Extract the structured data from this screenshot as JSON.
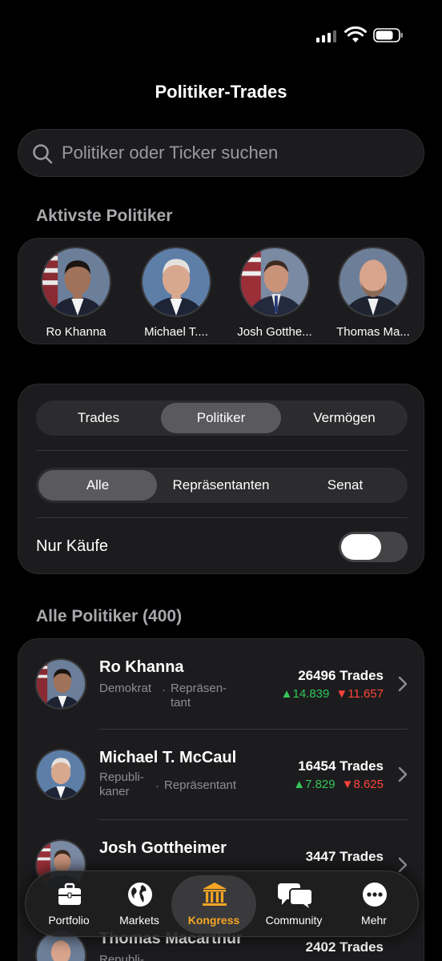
{
  "header": {
    "title": "Politiker-Trades"
  },
  "search": {
    "placeholder": "Politiker oder Ticker suchen"
  },
  "active_section": {
    "title": "Aktivste Politiker",
    "politicians": [
      {
        "name": "Ro Khanna"
      },
      {
        "name": "Michael T...."
      },
      {
        "name": "Josh Gotthe..."
      },
      {
        "name": "Thomas Ma..."
      }
    ]
  },
  "filters": {
    "view_tabs": [
      "Trades",
      "Politiker",
      "Vermögen"
    ],
    "view_selected": "Politiker",
    "chamber_tabs": [
      "Alle",
      "Repräsentanten",
      "Senat"
    ],
    "chamber_selected": "Alle",
    "buys_only_label": "Nur Käufe",
    "buys_only": false
  },
  "list": {
    "title": "Alle Politiker (400)",
    "rows": [
      {
        "name": "Ro Khanna",
        "party": "Demokrat",
        "chamber": "Repräsen-tant",
        "trades": "26496 Trades",
        "up": "▲14.839",
        "down": "▼11.657"
      },
      {
        "name": "Michael T. McCaul",
        "party": "Republi-kaner",
        "chamber": "Repräsentant",
        "trades": "16454 Trades",
        "up": "▲7.829",
        "down": "▼8.625"
      },
      {
        "name": "Josh Gottheimer",
        "party": "",
        "chamber": "",
        "trades": "3447 Trades",
        "up": "",
        "down": ""
      },
      {
        "name": "Thomas Macarthur",
        "party": "Republi-",
        "chamber": "",
        "trades": "2402 Trades",
        "up": "",
        "down": ""
      }
    ]
  },
  "tab_bar": {
    "items": [
      {
        "label": "Portfolio",
        "icon": "briefcase-icon"
      },
      {
        "label": "Markets",
        "icon": "globe-icon"
      },
      {
        "label": "Kongress",
        "icon": "capitol-icon"
      },
      {
        "label": "Community",
        "icon": "chat-bubbles-icon"
      },
      {
        "label": "Mehr",
        "icon": "more-dots-icon"
      }
    ],
    "active": "Kongress",
    "active_color": "#f5a623"
  },
  "colors": {
    "up": "#34c759",
    "down": "#ff453a",
    "background": "#000000",
    "card": "#1c1c1e"
  }
}
